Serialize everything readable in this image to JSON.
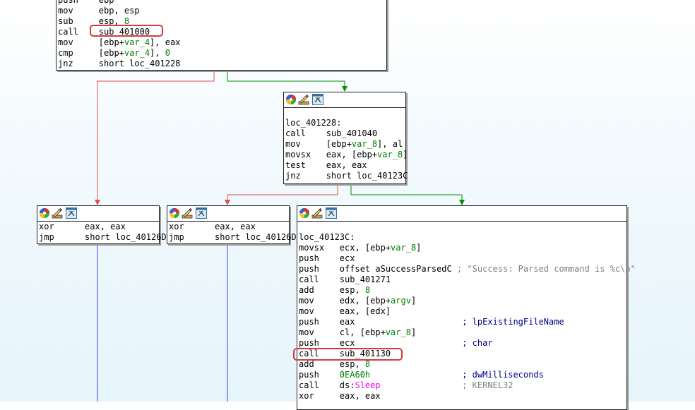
{
  "colors": {
    "edge_false": "#e05050",
    "edge_true": "#009000",
    "edge_uncond": "#4040ff",
    "highlight": "#d03c3c"
  },
  "icons": [
    "color-palette-icon",
    "edit-icon",
    "graph-icon"
  ],
  "nodes": {
    "top": {
      "lines": [
        {
          "m": "push",
          "o": "ebp"
        },
        {
          "m": "mov",
          "o": "ebp, esp"
        },
        {
          "m": "sub",
          "o": "esp, ",
          "n": "8"
        },
        {
          "m": "call",
          "o": "sub_401000"
        },
        {
          "m": "mov",
          "o1": "[ebp+",
          "v": "var_4",
          "o2": "], eax"
        },
        {
          "m": "cmp",
          "o1": "[ebp+",
          "v": "var_4",
          "o2": "], ",
          "n": "0"
        },
        {
          "m": "jnz",
          "o": "short loc_401228"
        }
      ]
    },
    "loc_401228": {
      "lines": [
        {
          "label": "loc_401228:"
        },
        {
          "m": "call",
          "o": "sub_401040"
        },
        {
          "m": "mov",
          "o1": "[ebp+",
          "v": "var_8",
          "o2": "], al"
        },
        {
          "m": "movsx",
          "o1": "eax, [ebp+",
          "v": "var_8",
          "o2": "]"
        },
        {
          "m": "test",
          "o": "eax, eax"
        },
        {
          "m": "jnz",
          "o": "short loc_40123C"
        }
      ]
    },
    "left1": {
      "lines": [
        {
          "m": "xor",
          "o": "eax, eax"
        },
        {
          "m": "jmp",
          "o": "short loc_40126D"
        }
      ]
    },
    "left2": {
      "lines": [
        {
          "m": "xor",
          "o": "eax, eax"
        },
        {
          "m": "jmp",
          "o": "short loc_40126D"
        }
      ]
    },
    "loc_40123C": {
      "lines": [
        {
          "label": "loc_40123C:"
        },
        {
          "m": "movsx",
          "o1": "ecx, [ebp+",
          "v": "var_8",
          "o2": "]"
        },
        {
          "m": "push",
          "o": "ecx"
        },
        {
          "m": "push",
          "o": "offset aSuccessParsedC",
          "c": "; \"Success: Parsed command is %c\\n\""
        },
        {
          "m": "call",
          "o": "sub_401271"
        },
        {
          "m": "add",
          "o": "esp, ",
          "n": "8"
        },
        {
          "m": "mov",
          "o1": "edx, [ebp+",
          "v": "argv",
          "o2": "]"
        },
        {
          "m": "mov",
          "o": "eax, [edx]"
        },
        {
          "m": "push",
          "o": "eax",
          "cb": "; lpExistingFileName"
        },
        {
          "m": "mov",
          "o1": "cl, [ebp+",
          "v": "var_8",
          "o2": "]"
        },
        {
          "m": "push",
          "o": "ecx",
          "cb": "; char"
        },
        {
          "m": "call",
          "o": "sub_401130"
        },
        {
          "m": "add",
          "o": "esp, ",
          "n": "8"
        },
        {
          "m": "push",
          "o": "",
          "n": "0EA60h",
          "cb": "; dwMilliseconds"
        },
        {
          "m": "call",
          "o": "ds:",
          "imp": "Sleep",
          "cr": "; KERNEL32"
        },
        {
          "m": "xor",
          "o": "eax, eax"
        }
      ]
    }
  }
}
